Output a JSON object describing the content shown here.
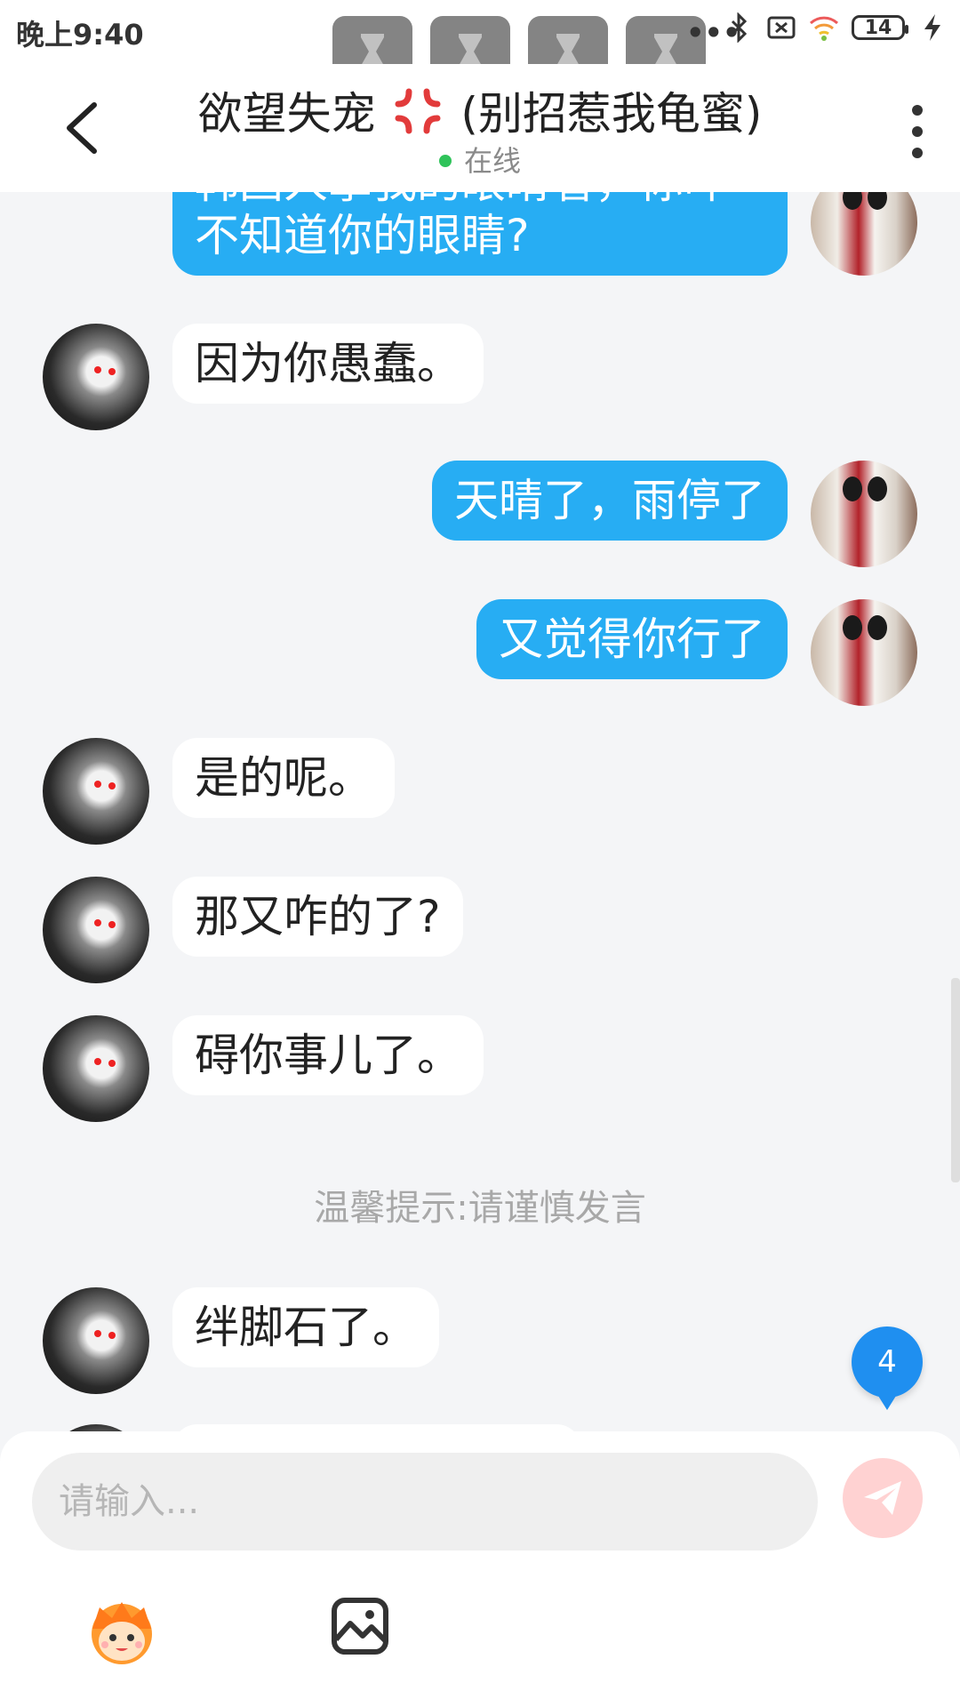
{
  "status_bar": {
    "time": "晚上9:40",
    "battery": "14",
    "more": "•••"
  },
  "header": {
    "title_name": "欲望失宠",
    "title_suffix": "(别招惹我龟蜜)",
    "status": "在线"
  },
  "messages": [
    {
      "side": "me",
      "text": "韩国人拿我的眼睛看，你咋不知道你的眼睛?"
    },
    {
      "side": "other",
      "text": "因为你愚蠢。"
    },
    {
      "side": "me",
      "text": "天晴了，雨停了"
    },
    {
      "side": "me",
      "text": "又觉得你行了"
    },
    {
      "side": "other",
      "text": "是的呢。"
    },
    {
      "side": "other",
      "text": "那又咋的了?"
    },
    {
      "side": "other",
      "text": "碍你事儿了。"
    },
    {
      "side": "other",
      "text": "绊脚石了。"
    }
  ],
  "tip": "温馨提示:请谨慎发言",
  "unread_badge": "4",
  "composer": {
    "placeholder": "请输入..."
  },
  "colors": {
    "my_bubble": "#27adf3",
    "other_bubble": "#ffffff",
    "online_dot": "#2fc35a",
    "badge": "#1f8ff0",
    "send_button": "#ffd2d2"
  }
}
